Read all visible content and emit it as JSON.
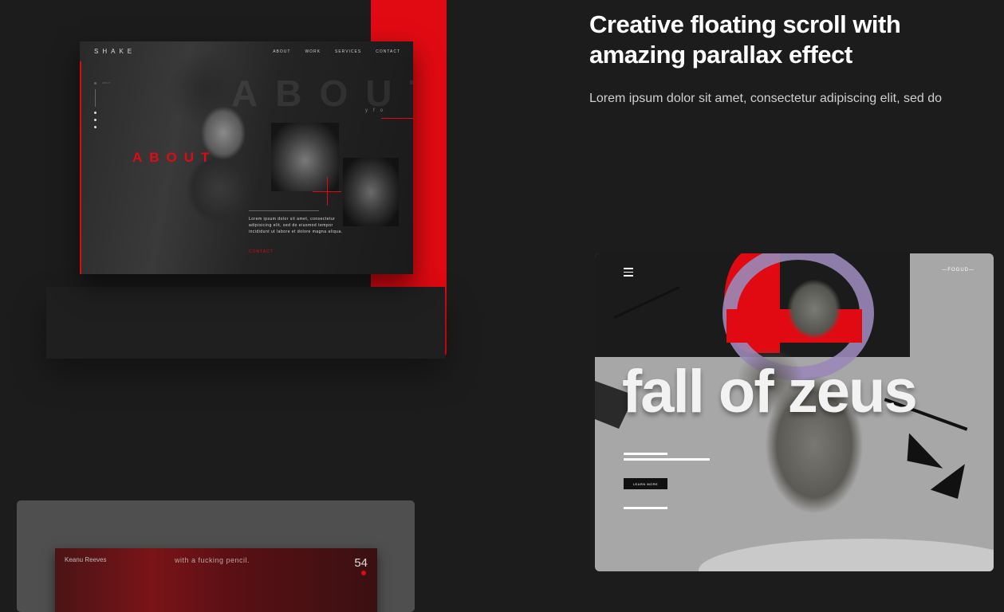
{
  "shake_card": {
    "logo": "SHAKE",
    "nav": [
      "ABOUT",
      "WORK",
      "SERVICES",
      "CONTACT"
    ],
    "bg_word": "ABOUT",
    "social": [
      "y",
      "f",
      "o"
    ],
    "title": "ABOUT",
    "body": "Lorem ipsum dolor sit amet, consectetur adipisicing elit, sed do eiusmod tempor incididunt ut labore et dolore magna aliqua.",
    "contact": "CONTACT",
    "side_label": "ABOUT"
  },
  "headline": "Creative floating scroll with amazing parallax effect",
  "subtext": "Lorem ipsum dolor sit amet, consectetur adipiscing elit, sed do",
  "zeus_card": {
    "brand": "—FOGUD—",
    "title": "fall of zeus",
    "button": "LEARN MORE"
  },
  "bottom_card": {
    "name": "Keanu Reeves",
    "caption": "with a fucking pencil.",
    "number": "54"
  },
  "colors": {
    "accent": "#e10a12",
    "background": "#1c1c1d",
    "zeus_bg": "#a7a7a7"
  }
}
